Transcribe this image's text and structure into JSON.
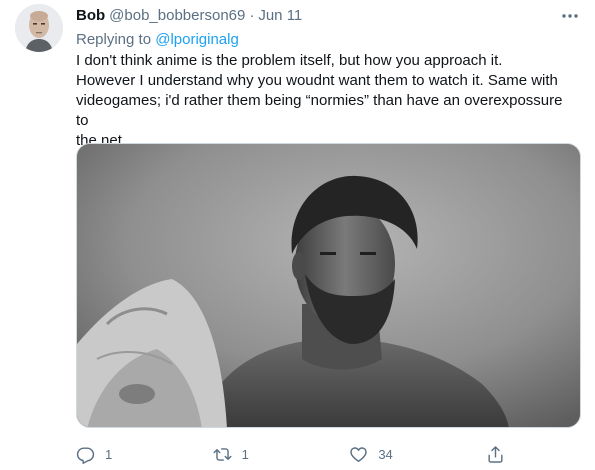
{
  "tweet": {
    "author": {
      "name": "Bob",
      "handle": "@bob_bobberson69",
      "avatar_icon": "avatar-icon"
    },
    "separator": "·",
    "date": "Jun 11",
    "replying_prefix": "Replying to ",
    "replying_mention": "@lporiginalg",
    "text_lines": [
      "I don't think anime is the problem itself, but how you approach it.",
      "However I understand why you woudnt want them to watch it. Same with",
      "videogames; i'd rather them being “normies” than have an overexpossure to",
      "the net."
    ],
    "media": {
      "kind": "photo",
      "tone": "grayscale"
    },
    "stats": {
      "replies": "1",
      "retweets": "1",
      "likes": "34"
    }
  },
  "colors": {
    "text": "#0f1419",
    "secondary": "#5b7083",
    "link": "#1da1f2",
    "border": "#cfd9de"
  },
  "icons": {
    "more": "more-horizontal-icon",
    "reply": "reply-icon",
    "retweet": "retweet-icon",
    "like": "heart-icon",
    "share": "share-icon"
  }
}
